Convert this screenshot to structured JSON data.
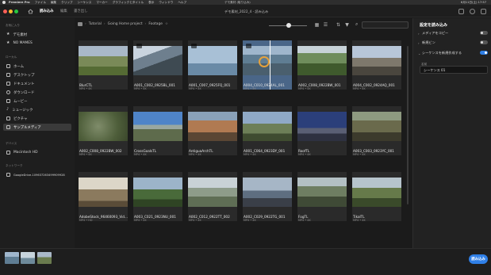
{
  "menubar": {
    "app": "Premiere Pro",
    "items": [
      "ファイル",
      "編集",
      "クリップ",
      "シーケンス",
      "マーカー",
      "グラフィックとタイトル",
      "表示",
      "ウィンドウ",
      "ヘルプ"
    ],
    "doc_title": "デモ素材 (取り込み)",
    "clock": "6月11日(土) 17:57"
  },
  "appbar": {
    "tabs": [
      "読み込み",
      "編集",
      "書き出し"
    ],
    "active_tab": 0,
    "title": "デモ素材_2022_4 - 読み込み"
  },
  "sidebar": {
    "favorites_header": "お気に入り",
    "favorites": [
      "デモ素材",
      "NO MAMES"
    ],
    "local_header": "ローカル",
    "local": [
      "ホーム",
      "デスクトップ",
      "ドキュメント",
      "ダウンロード",
      "ムービー",
      "ミュージック",
      "ピクチャ",
      "サンプルメディア"
    ],
    "selected_local": 7,
    "devices_header": "デバイス",
    "devices": [
      "Macintosh HD"
    ],
    "network_header": "ネットワーク",
    "network": [
      "GoogleDrive-109637263499909928"
    ]
  },
  "breadcrumb": [
    "Tutorial",
    "Going Home project",
    "Footage"
  ],
  "media": [
    {
      "name": "BlurCTL",
      "meta": "MP4 • 4K"
    },
    {
      "name": "A001_C002_0925BL_001",
      "meta": "MP4 • 4K"
    },
    {
      "name": "A001_C007_0925FQ_001",
      "meta": "MP4 • 4K"
    },
    {
      "name": "A004_C010_0924AL_001",
      "meta": "MP4 • 4K"
    },
    {
      "name": "A002_C008_0922BW_001",
      "meta": "MP4 • 4K"
    },
    {
      "name": "A004_C002_0924AQ_001",
      "meta": "MP4 • 4K"
    },
    {
      "name": "A002_C008_0922BW_002",
      "meta": "MP4 • 4K"
    },
    {
      "name": "CrossGoalsTL",
      "meta": "MP4 • 4K"
    },
    {
      "name": "AntiguaArchTL",
      "meta": "MP4 • 4K"
    },
    {
      "name": "A001_C064_0923DY_001",
      "meta": "MP4 • 4K"
    },
    {
      "name": "RoofTL",
      "meta": "MP4 • 4K"
    },
    {
      "name": "A003_C003_0923YC_001",
      "meta": "MP4 • 4K"
    },
    {
      "name": "AdobeStock_96460093_Vid…",
      "meta": "MP4 • HD"
    },
    {
      "name": "A003_C021_0923NU_001",
      "meta": "MP4 • 4K"
    },
    {
      "name": "A002_C012_0922TT_002",
      "meta": "MP4 • 4K"
    },
    {
      "name": "A002_C029_0922TG_001",
      "meta": "MP4 • 4K"
    },
    {
      "name": "FogTL",
      "meta": "MP4 • 4K"
    },
    {
      "name": "TikalTL",
      "meta": "MP4 • 4K"
    }
  ],
  "selected_media": 3,
  "right_panel": {
    "title": "設定を読み込み",
    "rows": [
      {
        "label": "メディアをコピー",
        "on": false
      },
      {
        "label": "新規ビン",
        "on": false
      },
      {
        "label": "シーケンスを新規作成する",
        "on": true
      }
    ],
    "name_label": "名前",
    "sequence_name": "シーケンス 01"
  },
  "bottom": {
    "import_label": "読み込み"
  },
  "colors": {
    "accent": "#2f7fe6",
    "selected_tile": "#4a6688",
    "scrub_ring": "#e6a23c"
  }
}
